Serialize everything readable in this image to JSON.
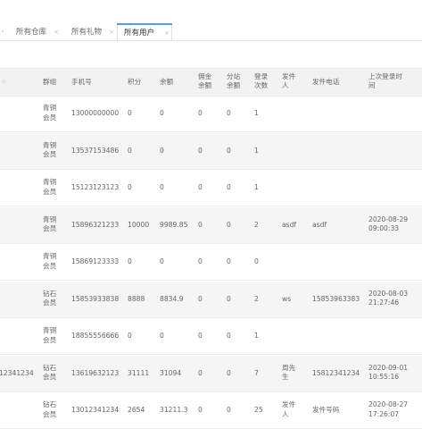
{
  "tabs": [
    {
      "label": "所有仓库",
      "active": false
    },
    {
      "label": "所有礼物",
      "active": false
    },
    {
      "label": "所有用户",
      "active": true
    }
  ],
  "tab_close_glyph": "×",
  "table": {
    "headers": {
      "sort_glyph": "◇",
      "level": "群组",
      "phone": "手机号",
      "points": "积分",
      "balance": "余额",
      "commission": "佣金\n余额",
      "branch": "分站\n余额",
      "logins": "登录\n次数",
      "sender": "发件\n人",
      "sender_phone": "发件电话",
      "last_login": "上次登录时\n间"
    },
    "rows": [
      {
        "first": "",
        "level": "青铜\n会员",
        "phone": "13000000000",
        "points": "0",
        "balance": "0",
        "commission": "0",
        "branch": "0",
        "logins": "1",
        "sender": "",
        "sender_phone": "",
        "last_login": ""
      },
      {
        "first": "",
        "level": "青铜\n会员",
        "phone": "13537153486",
        "points": "0",
        "balance": "0",
        "commission": "0",
        "branch": "0",
        "logins": "1",
        "sender": "",
        "sender_phone": "",
        "last_login": ""
      },
      {
        "first": "",
        "level": "青铜\n会员",
        "phone": "15123123123",
        "points": "0",
        "balance": "0",
        "commission": "0",
        "branch": "0",
        "logins": "1",
        "sender": "",
        "sender_phone": "",
        "last_login": ""
      },
      {
        "first": "",
        "level": "青铜\n会员",
        "phone": "15896321233",
        "points": "10000",
        "balance": "9989.85",
        "commission": "0",
        "branch": "0",
        "logins": "2",
        "sender": "asdf",
        "sender_phone": "asdf",
        "last_login": "2020-08-29\n09:00:33"
      },
      {
        "first": "",
        "level": "青铜\n会员",
        "phone": "15869123333",
        "points": "0",
        "balance": "0",
        "commission": "0",
        "branch": "0",
        "logins": "0",
        "sender": "",
        "sender_phone": "",
        "last_login": ""
      },
      {
        "first": "",
        "level": "钻石\n会员",
        "phone": "15853933838",
        "points": "8888",
        "balance": "8834.9",
        "commission": "0",
        "branch": "0",
        "logins": "2",
        "sender": "ws",
        "sender_phone": "15853963383",
        "last_login": "2020-08-03\n21:27:46"
      },
      {
        "first": "",
        "level": "青铜\n会员",
        "phone": "18855556666",
        "points": "0",
        "balance": "0",
        "commission": "0",
        "branch": "0",
        "logins": "1",
        "sender": "",
        "sender_phone": "",
        "last_login": ""
      },
      {
        "first": "12341234",
        "level": "钻石\n会员",
        "phone": "13619632123",
        "points": "31111",
        "balance": "31094",
        "commission": "0",
        "branch": "0",
        "logins": "7",
        "sender": "周先\n生",
        "sender_phone": "15812341234",
        "last_login": "2020-09-01\n10:55:16"
      },
      {
        "first": "",
        "level": "钻石\n会员",
        "phone": "13012341234",
        "points": "2654",
        "balance": "31211.3",
        "commission": "0",
        "branch": "0",
        "logins": "25",
        "sender": "发件\n人",
        "sender_phone": "发件号码",
        "last_login": "2020-08-27\n17:26:07"
      }
    ]
  }
}
